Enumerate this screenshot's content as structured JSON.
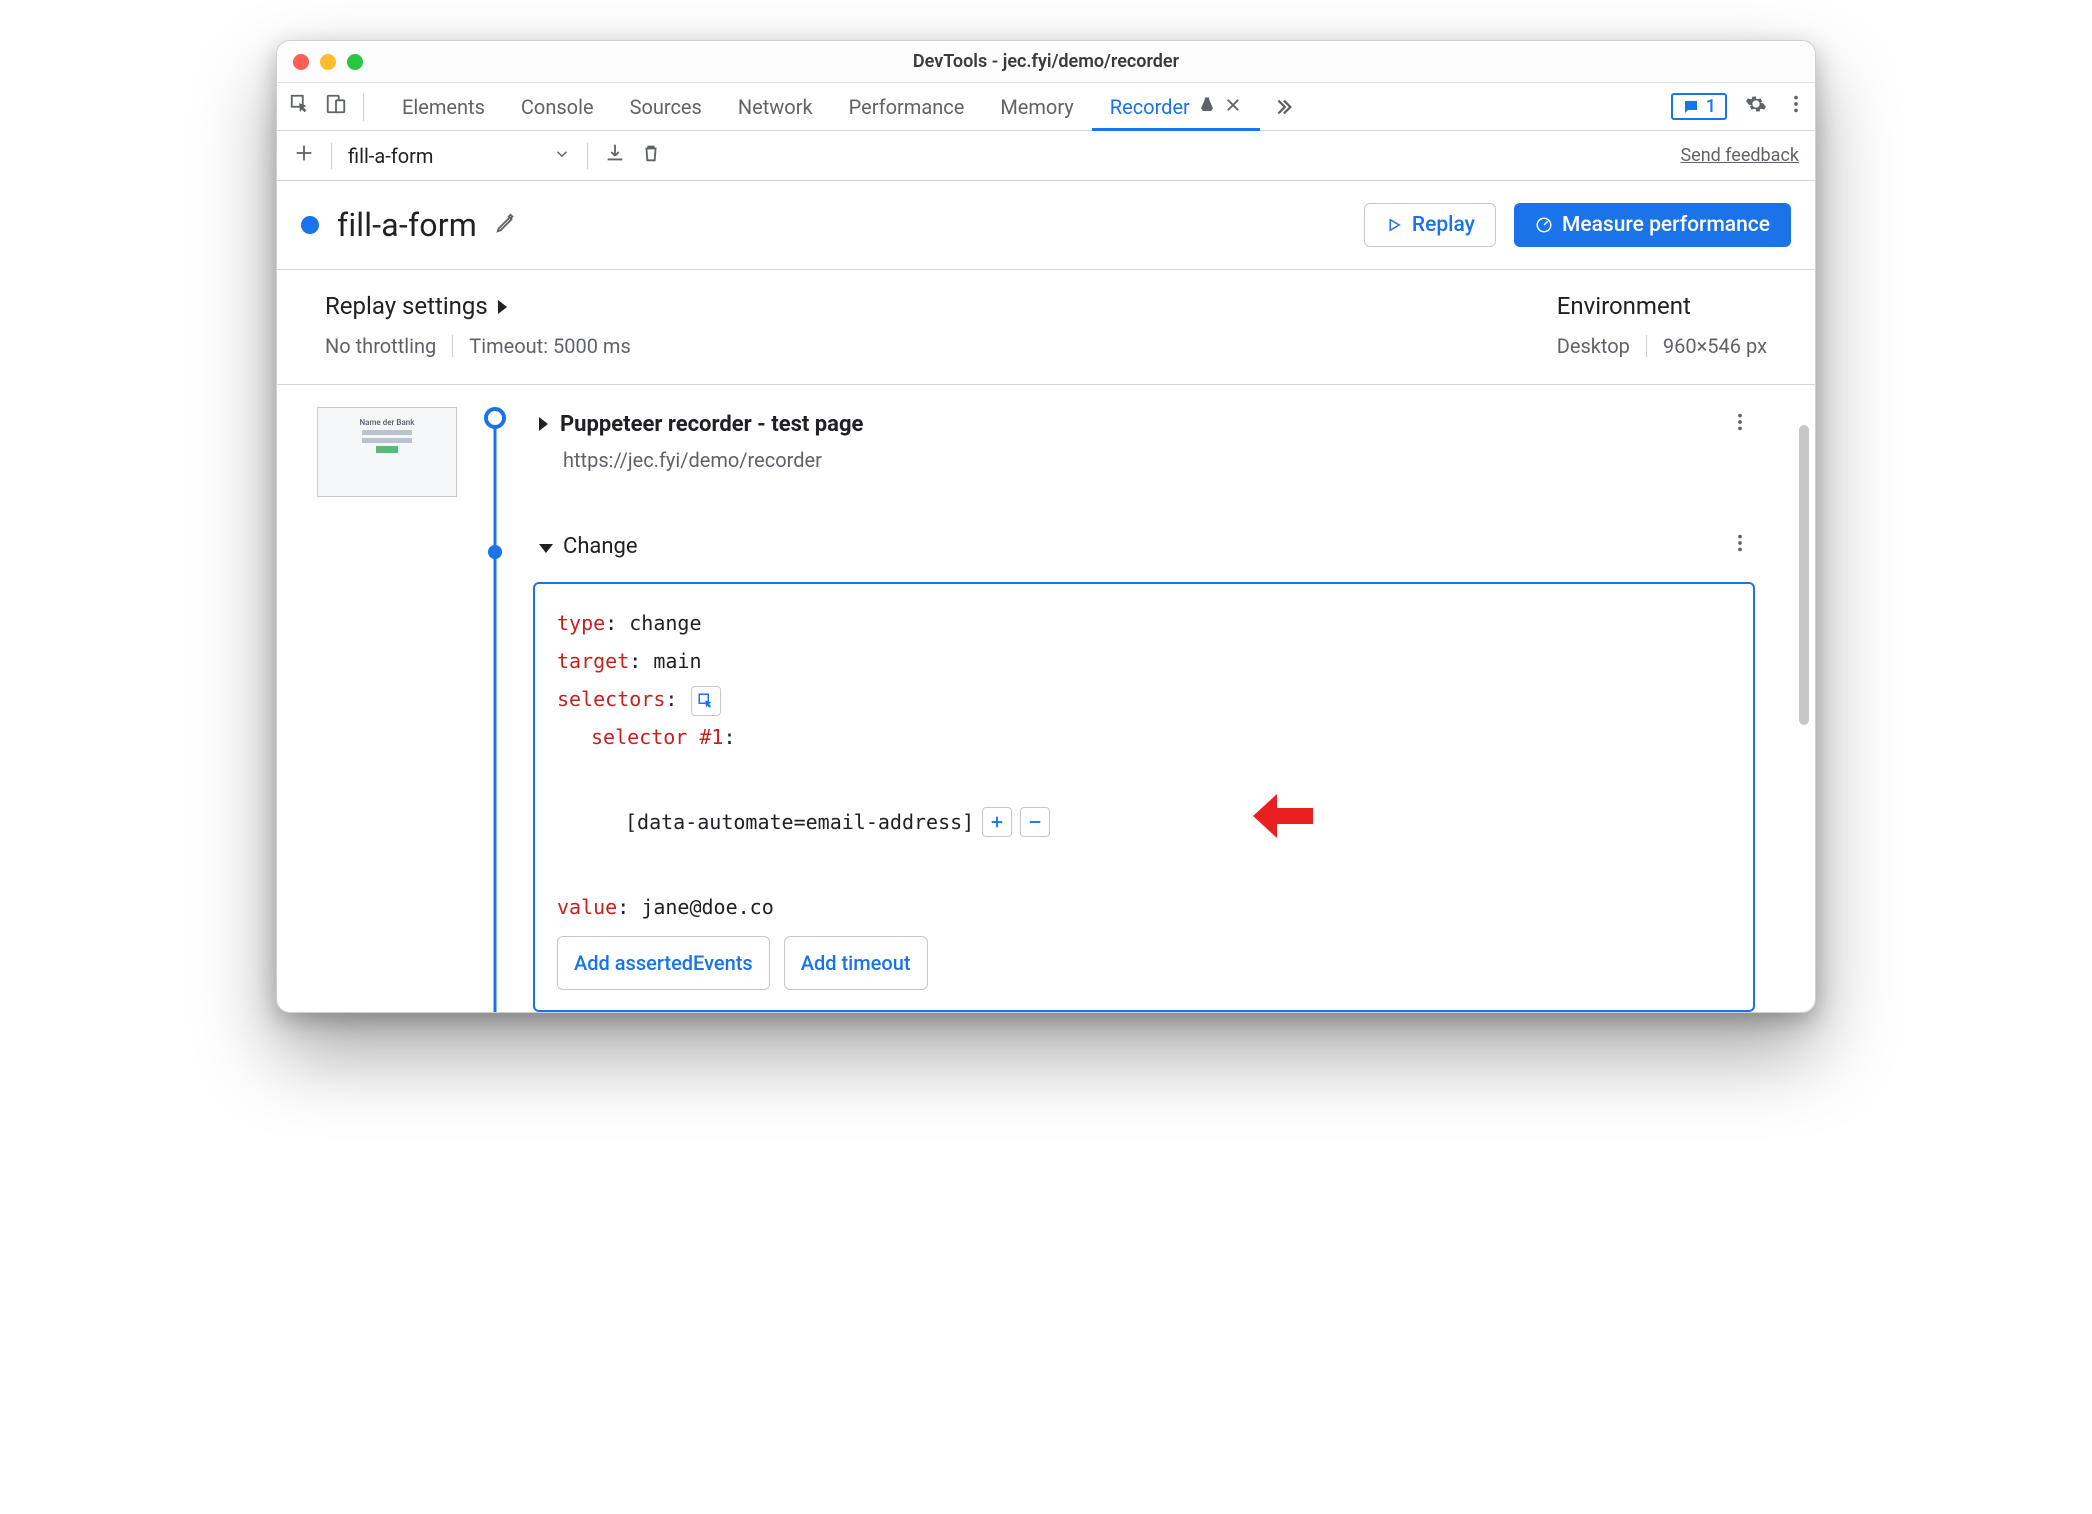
{
  "window": {
    "title": "DevTools - jec.fyi/demo/recorder"
  },
  "tabs": {
    "items": [
      "Elements",
      "Console",
      "Sources",
      "Network",
      "Performance",
      "Memory",
      "Recorder"
    ],
    "activeIndex": 6
  },
  "badge": {
    "count": "1"
  },
  "toolbar": {
    "selected_recording": "fill-a-form",
    "send_feedback": "Send feedback"
  },
  "header": {
    "title": "fill-a-form",
    "replay_label": "Replay",
    "measure_label": "Measure performance"
  },
  "settings": {
    "replay_heading": "Replay settings",
    "throttling": "No throttling",
    "timeout": "Timeout: 5000 ms",
    "env_heading": "Environment",
    "env_device": "Desktop",
    "env_size": "960×546 px"
  },
  "steps": {
    "start": {
      "title": "Puppeteer recorder - test page",
      "url": "https://jec.fyi/demo/recorder"
    },
    "change": {
      "label": "Change",
      "type_key": "type",
      "type_val": "change",
      "target_key": "target",
      "target_val": "main",
      "selectors_key": "selectors",
      "selector1_key": "selector #1",
      "selector1_val": "[data-automate=email-address]",
      "value_key": "value",
      "value_val": "jane@doe.co",
      "add_asserted": "Add assertedEvents",
      "add_timeout": "Add timeout"
    }
  }
}
